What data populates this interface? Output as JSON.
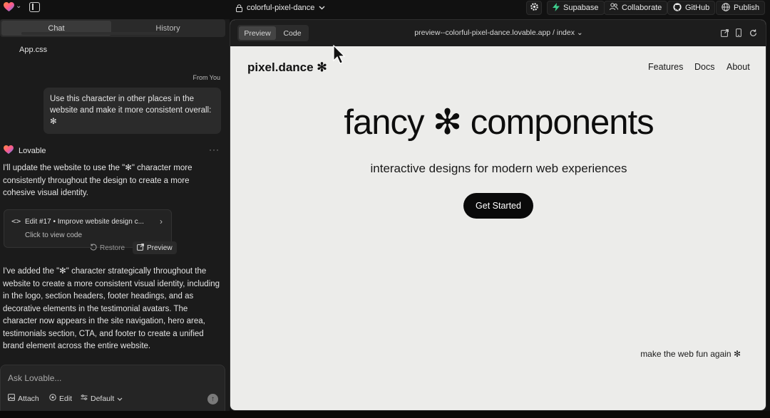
{
  "topbar": {
    "project_name": "colorful-pixel-dance",
    "buttons": [
      {
        "label": "Supabase",
        "icon": "bolt-icon"
      },
      {
        "label": "Collaborate",
        "icon": "users-icon"
      },
      {
        "label": "GitHub",
        "icon": "github-icon"
      },
      {
        "label": "Publish",
        "icon": "globe-icon"
      }
    ]
  },
  "chat": {
    "tabs": [
      "Chat",
      "History"
    ],
    "file_ref": "App.css",
    "from_you": "From You",
    "user_message": "Use this character in other places in the website and make it more consistent overall: ✻",
    "agent_name": "Lovable",
    "agent_menu": "···",
    "agent_message_1": "I'll update the website to use the \"✻\" character more consistently throughout the design to create a more cohesive visual identity.",
    "edit_card": {
      "title": "Edit #17 • Improve website design c...",
      "subtitle": "Click to view code"
    },
    "restore_label": "Restore",
    "preview_label": "Preview",
    "agent_message_2": "I've added the \"✻\" character strategically throughout the website to create a more consistent visual identity, including in the logo, section headers, footer headings, and as decorative elements in the testimonial avatars. The character now appears in the site navigation, hero area, testimonials section, CTA, and footer to create a unified brand element across the entire website.",
    "composer": {
      "placeholder": "Ask Lovable...",
      "attach": "Attach",
      "edit": "Edit",
      "mode": "Default"
    }
  },
  "preview": {
    "tabs": [
      "Preview",
      "Code"
    ],
    "url": "preview--colorful-pixel-dance.lovable.app / index",
    "site": {
      "logo": "pixel.dance ✻",
      "nav": [
        "Features",
        "Docs",
        "About"
      ],
      "hero": "fancy ✻ components",
      "tagline": "interactive designs for modern web experiences",
      "cta": "Get Started",
      "motto": "make the web fun again ✻"
    }
  }
}
